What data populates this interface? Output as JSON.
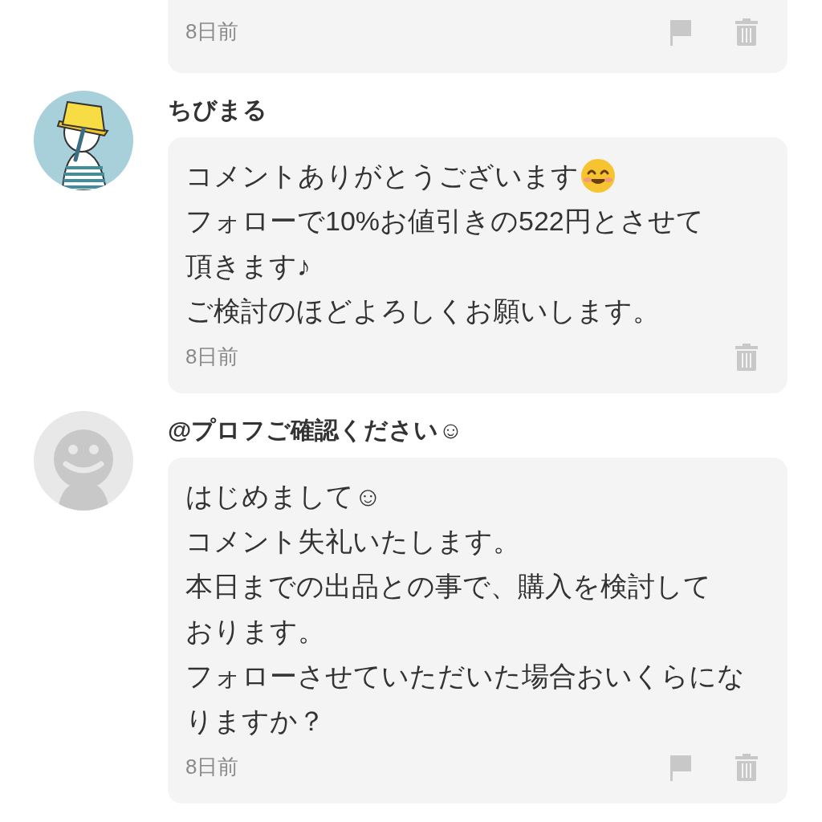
{
  "comments": [
    {
      "kind": "partial",
      "time": "8日前",
      "reportable": true
    },
    {
      "kind": "full",
      "avatar": {
        "kind": "illustration"
      },
      "username": "ちびまる",
      "lines": [
        "コメントありがとうございます",
        "フォローで10%お値引きの522円とさせて",
        "頂きます♪",
        "ご検討のほどよろしくお願いします。"
      ],
      "emoji_after_first_line": true,
      "time": "8日前",
      "reportable": false
    },
    {
      "kind": "full",
      "avatar": {
        "kind": "default"
      },
      "username": "@プロフご確認ください☺",
      "lines": [
        "はじめまして☺",
        "コメント失礼いたします。",
        "本日までの出品との事で、購入を検討して",
        "おります。",
        "フォローさせていただいた場合おいくらにな",
        "りますか？"
      ],
      "emoji_after_first_line": false,
      "time": "8日前",
      "reportable": true
    }
  ]
}
